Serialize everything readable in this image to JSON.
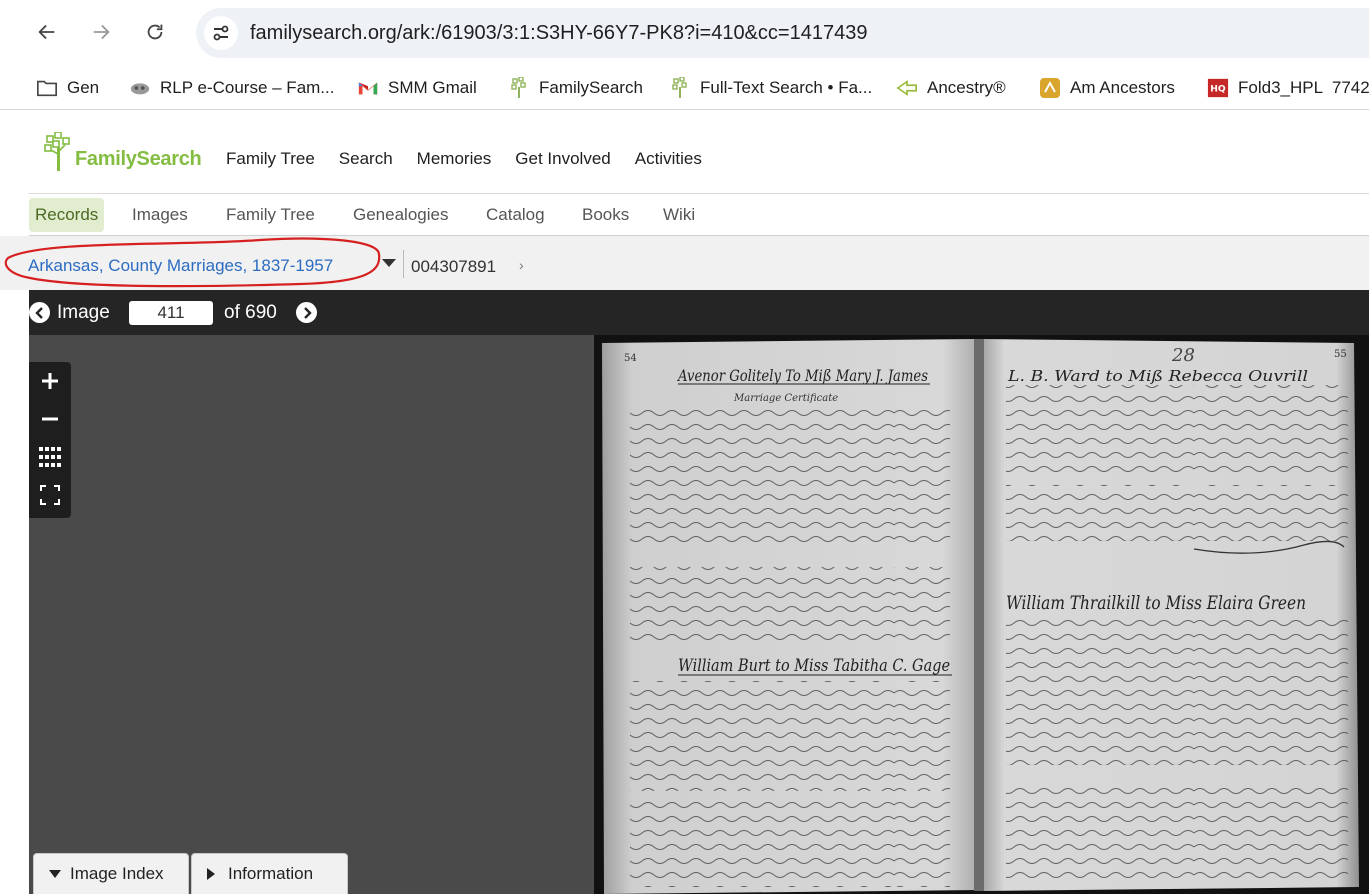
{
  "browser": {
    "url": "familysearch.org/ark:/61903/3:1:S3HY-66Y7-PK8?i=410&cc=1417439",
    "bookmarks": [
      {
        "label": "Gen",
        "icon": "folder-icon"
      },
      {
        "label": "RLP e-Course – Fam...",
        "icon": "rlp-icon"
      },
      {
        "label": "SMM Gmail",
        "icon": "gmail-icon"
      },
      {
        "label": "FamilySearch",
        "icon": "familysearch-tree-icon"
      },
      {
        "label": "Full-Text Search • Fa...",
        "icon": "familysearch-tree-icon"
      },
      {
        "label": "Ancestry®",
        "icon": "ancestry-leaf-icon"
      },
      {
        "label": "Am Ancestors",
        "icon": "am-ancestors-icon"
      },
      {
        "label": "Fold3_HPL  7742",
        "icon": "fold3-icon"
      }
    ]
  },
  "site": {
    "logo_text": "FamilySearch",
    "main_nav": [
      "Family Tree",
      "Search",
      "Memories",
      "Get Involved",
      "Activities"
    ],
    "sub_nav": [
      "Records",
      "Images",
      "Family Tree",
      "Genealogies",
      "Catalog",
      "Books",
      "Wiki"
    ],
    "sub_nav_active": "Records"
  },
  "breadcrumb": {
    "collection": "Arkansas, County Marriages, 1837-1957",
    "film_number": "004307891"
  },
  "image_bar": {
    "image_label": "Image",
    "current": "411",
    "of_label": "of 690"
  },
  "document": {
    "left_page_number": "54",
    "right_page_number": "55",
    "pencil_number": "28",
    "left_heading_1": "Avenor Golitely To Miß Mary J. James",
    "left_subheading": "Marriage Certificate",
    "left_heading_2": "William Burt to Miss Tabitha C. Gage",
    "right_heading_1": "L. B. Ward to Miß Rebecca Ouvrill",
    "right_heading_2": "William Thrailkill to Miss Elaira Green"
  },
  "bottom_tabs": [
    "Image Index",
    "Information"
  ],
  "colors": {
    "logo_green": "#84bd42",
    "link_blue": "#2c6cc3",
    "annotation_red": "#d62020",
    "active_tab_bg": "#e2edcf"
  }
}
